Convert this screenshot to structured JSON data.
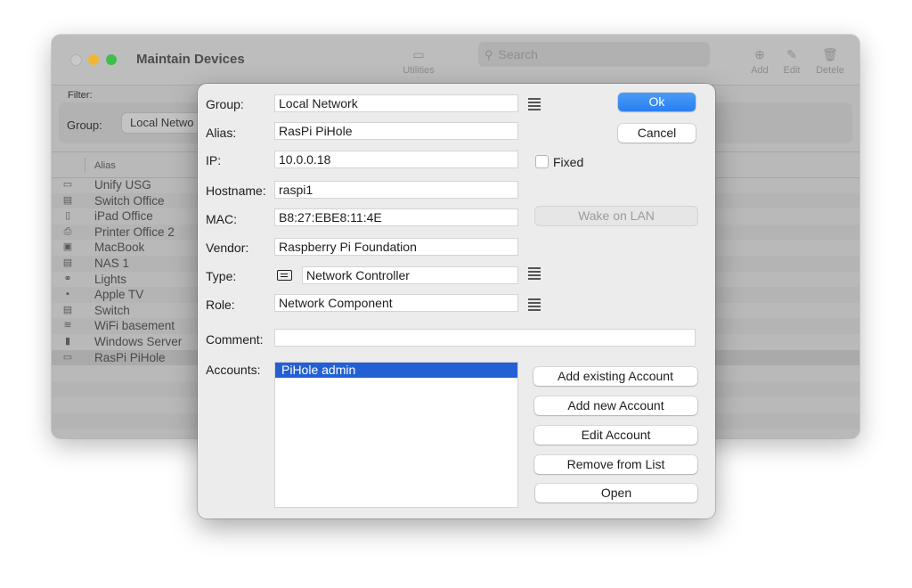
{
  "window": {
    "title": "Maintain Devices",
    "toolbar": {
      "utilities_label": "Utilities",
      "search_placeholder": "Search",
      "add_label": "Add",
      "edit_label": "Edit",
      "delete_label": "Detele"
    },
    "filter_label": "Filter:",
    "group_label": "Group:",
    "group_value": "Local Netwo",
    "column_alias": "Alias",
    "devices": [
      {
        "icon": "network-controller-icon",
        "glyph": "▭",
        "name": "Unify USG"
      },
      {
        "icon": "switch-icon",
        "glyph": "▤",
        "name": "Switch Office"
      },
      {
        "icon": "tablet-icon",
        "glyph": "▯",
        "name": "iPad Office"
      },
      {
        "icon": "printer-icon",
        "glyph": "⎙",
        "name": "Printer Office 2"
      },
      {
        "icon": "laptop-icon",
        "glyph": "▣",
        "name": "MacBook"
      },
      {
        "icon": "storage-icon",
        "glyph": "▤",
        "name": "NAS 1"
      },
      {
        "icon": "lights-icon",
        "glyph": "⚭",
        "name": "Lights"
      },
      {
        "icon": "appletv-icon",
        "glyph": "▪",
        "name": "Apple TV"
      },
      {
        "icon": "switch-icon",
        "glyph": "▤",
        "name": "Switch"
      },
      {
        "icon": "wifi-icon",
        "glyph": "≋",
        "name": "WiFi basement"
      },
      {
        "icon": "server-icon",
        "glyph": "▮",
        "name": "Windows Server"
      },
      {
        "icon": "network-controller-icon",
        "glyph": "▭",
        "name": "RasPi PiHole"
      }
    ]
  },
  "sheet": {
    "group_label": "Group:",
    "group_value": "Local Network",
    "alias_label": "Alias:",
    "alias_value": "RasPi PiHole",
    "ip_label": "IP:",
    "ip_value": "10.0.0.18",
    "fixed_label": "Fixed",
    "hostname_label": "Hostname:",
    "hostname_value": "raspi1",
    "mac_label": "MAC:",
    "mac_value": "B8:27:EBE8:11:4E",
    "vendor_label": "Vendor:",
    "vendor_value": "Raspberry Pi Foundation",
    "type_label": "Type:",
    "type_value": "Network Controller",
    "role_label": "Role:",
    "role_value": "Network Component",
    "comment_label": "Comment:",
    "comment_value": "",
    "accounts_label": "Accounts:",
    "accounts": [
      "PiHole admin"
    ],
    "buttons": {
      "ok": "Ok",
      "cancel": "Cancel",
      "wake_on_lan": "Wake on LAN",
      "add_existing_account": "Add existing Account",
      "add_new_account": "Add new Account",
      "edit_account": "Edit Account",
      "remove_from_list": "Remove from List",
      "open": "Open"
    },
    "fixed_checked": false
  },
  "colors": {
    "accent": "#2a7ff1",
    "selection": "#2360d3",
    "traffic_yellow": "#f1b733",
    "traffic_green": "#3dbf4b"
  }
}
